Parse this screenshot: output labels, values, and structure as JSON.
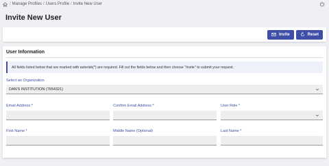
{
  "breadcrumb": {
    "items": [
      "Manage Profiles",
      "Users Profile",
      "Invite New User"
    ],
    "separator": "/"
  },
  "page_title": "Invite New User",
  "toolbar": {
    "invite_label": "Invite",
    "reset_label": "Reset"
  },
  "section": {
    "title": "User Information",
    "notice": "All fields listed below that are marked with asterisk(*) are required. Fill out the fields below and then choose \"Invite\" to submit your request."
  },
  "organization": {
    "label": "Select an Organization",
    "value": "DAN'S INSTITUTION (7654321)"
  },
  "fields": {
    "email": {
      "label": "Email Address",
      "required": "*",
      "value": ""
    },
    "confirm_email": {
      "label": "Confirm Email Address",
      "required": "*",
      "value": ""
    },
    "user_role": {
      "label": "User Role",
      "required": "*",
      "value": ""
    },
    "first_name": {
      "label": "First Name",
      "required": "*",
      "value": ""
    },
    "middle_name": {
      "label": "Middle Name (Optional)",
      "value": ""
    },
    "last_name": {
      "label": "Last Name",
      "required": "*",
      "value": ""
    }
  },
  "colors": {
    "accent": "#3f4fa8",
    "background": "#eef0f3",
    "field_bg": "#eeeef0"
  }
}
